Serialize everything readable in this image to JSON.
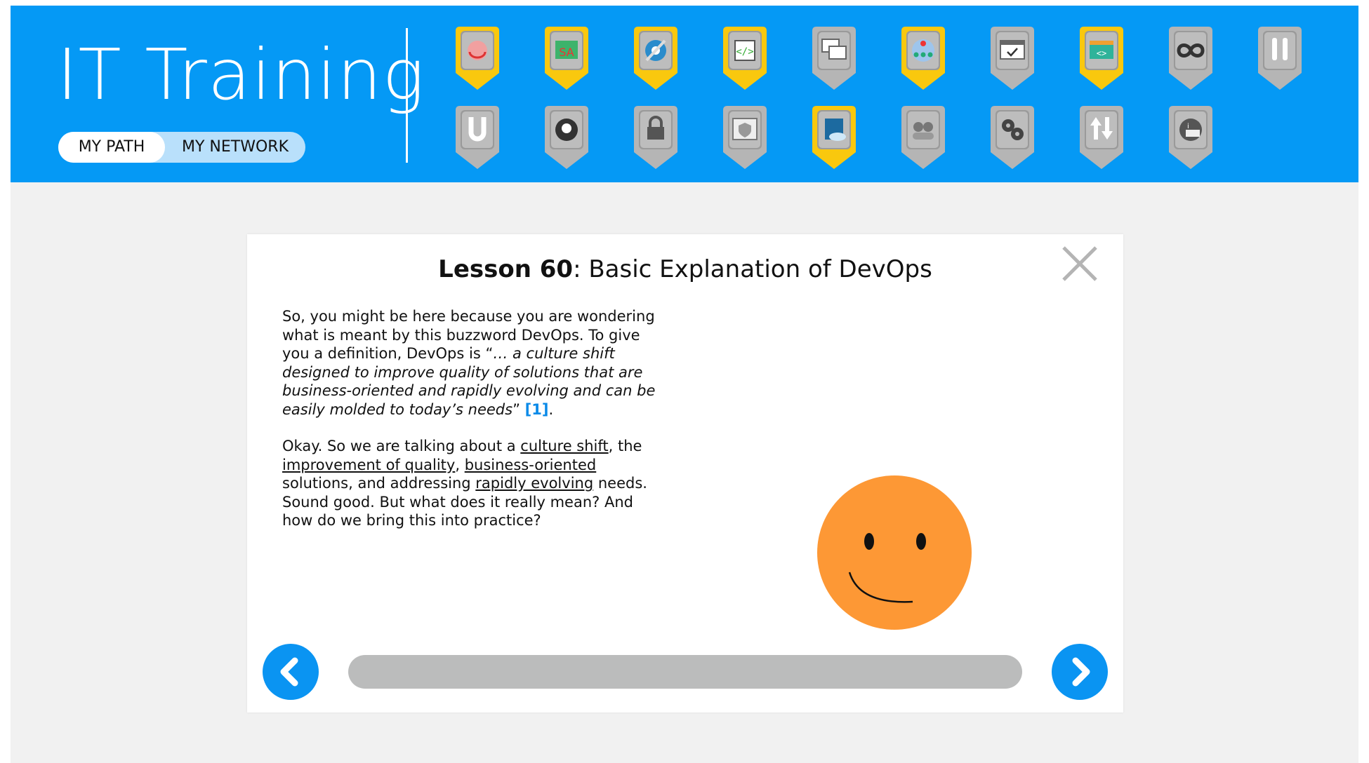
{
  "app": {
    "title": "IT Training"
  },
  "toggle": {
    "my_path": "MY PATH",
    "my_network": "MY NETWORK",
    "active": "MY PATH"
  },
  "badges": [
    {
      "id": "badge-1",
      "icon": "cycle-icon",
      "status": "completed"
    },
    {
      "id": "badge-2",
      "icon": "sa-chart-icon",
      "status": "completed"
    },
    {
      "id": "badge-3",
      "icon": "gears-cog-icon",
      "status": "completed"
    },
    {
      "id": "badge-4",
      "icon": "code-editor-icon",
      "status": "completed"
    },
    {
      "id": "badge-5",
      "icon": "windows-icon",
      "status": "locked"
    },
    {
      "id": "badge-6",
      "icon": "network-tree-icon",
      "status": "completed"
    },
    {
      "id": "badge-7",
      "icon": "browser-check-icon",
      "status": "locked"
    },
    {
      "id": "badge-8",
      "icon": "web-code-icon",
      "status": "completed"
    },
    {
      "id": "badge-9",
      "icon": "infinity-icon",
      "status": "locked"
    },
    {
      "id": "badge-10",
      "icon": "tools-icon",
      "status": "locked"
    },
    {
      "id": "badge-11",
      "icon": "pipe-icon",
      "status": "locked"
    },
    {
      "id": "badge-12",
      "icon": "lightbulb-cog-icon",
      "status": "locked"
    },
    {
      "id": "badge-13",
      "icon": "padlock-icon",
      "status": "locked"
    },
    {
      "id": "badge-14",
      "icon": "shield-icon",
      "status": "locked"
    },
    {
      "id": "badge-15",
      "icon": "server-cloud-icon",
      "status": "completed"
    },
    {
      "id": "badge-16",
      "icon": "team-icon",
      "status": "locked"
    },
    {
      "id": "badge-17",
      "icon": "gears-icon",
      "status": "locked"
    },
    {
      "id": "badge-18",
      "icon": "up-down-arrows-icon",
      "status": "locked"
    },
    {
      "id": "badge-19",
      "icon": "info-desk-icon",
      "status": "locked"
    }
  ],
  "colors": {
    "header_blue": "#0599f5",
    "badge_completed": "#f9c80e",
    "badge_locked": "#b5b5b5",
    "accent": "#0a94f2",
    "smiley": "#fd9835"
  },
  "lesson": {
    "number_label": "Lesson 60",
    "title": ": Basic Explanation of DevOps",
    "p1_intro": "So, you might be here because you are wondering what is meant by this buzzword DevOps. To give you a definition, DevOps is “",
    "p1_quote": "… a culture shift designed to improve quality of solutions that are business-oriented and rapidly evolving and can be easily molded to today’s needs",
    "p1_close": "” ",
    "p1_ref": "[1]",
    "p1_end": ".",
    "p2_a": "Okay. So we are talking about a ",
    "p2_link1": "culture shift",
    "p2_b": ", the ",
    "p2_link2": "improvement of quality",
    "p2_c": ", ",
    "p2_link3": "business-oriented",
    "p2_d": " solutions, and addressing ",
    "p2_link4": "rapidly evolving",
    "p2_e": " needs. Sound good. But what does it really mean? And how do we bring this into practice?"
  },
  "progress": {
    "fraction": 0
  }
}
